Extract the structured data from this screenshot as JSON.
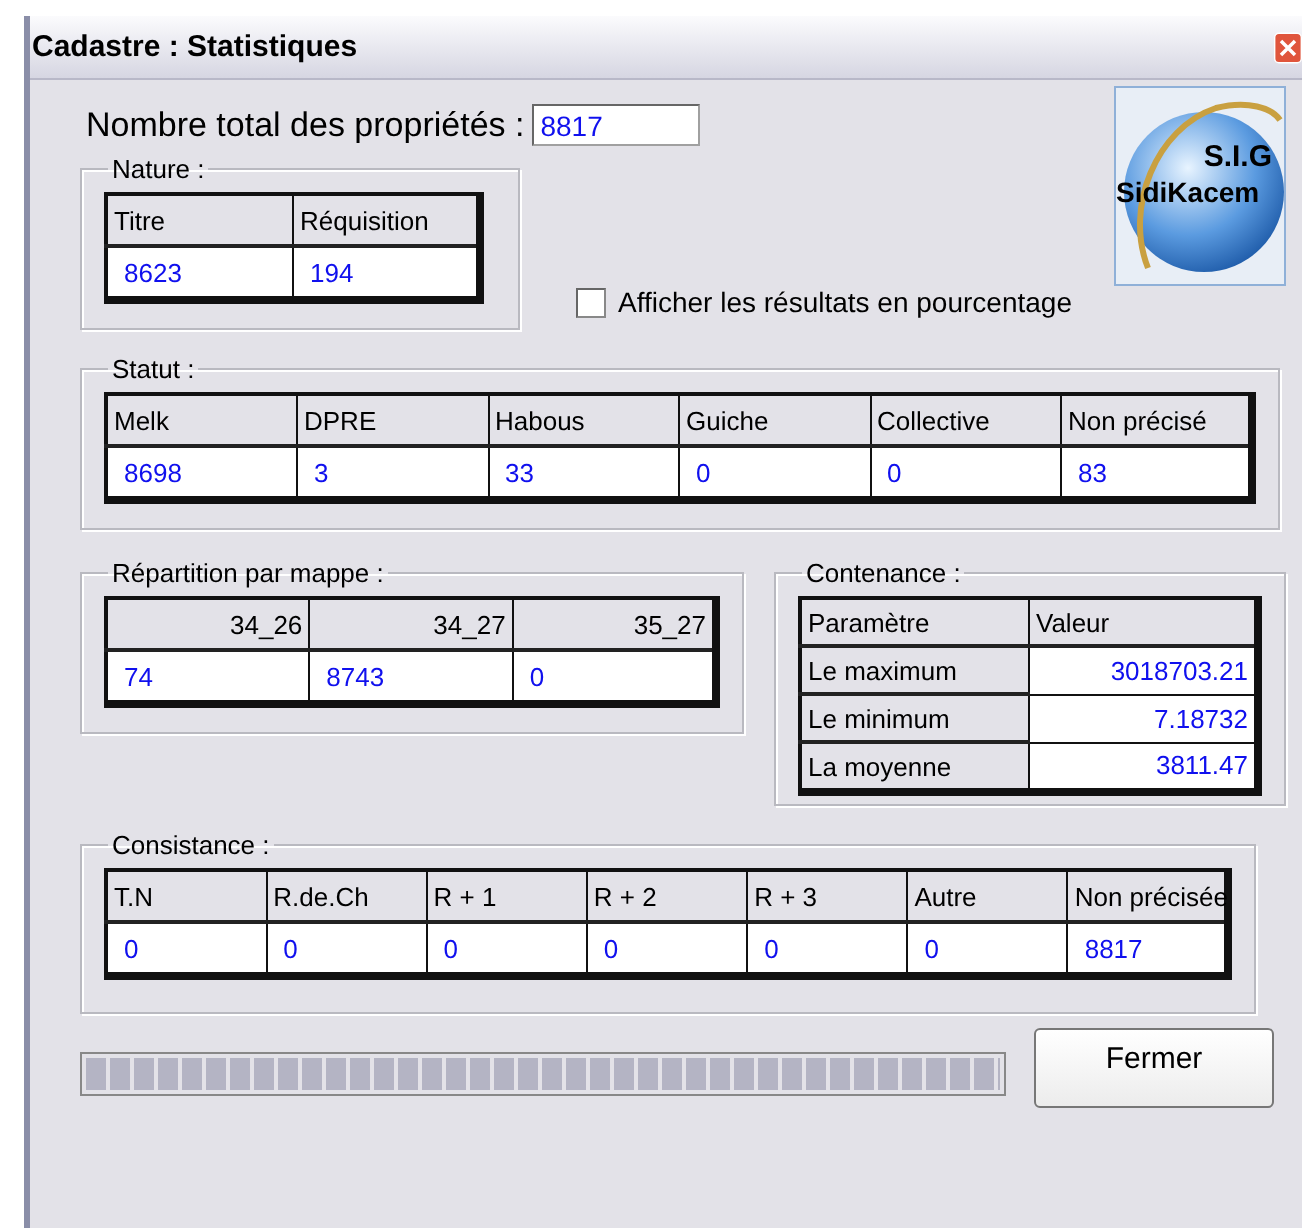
{
  "window": {
    "title": "Cadastre : Statistiques"
  },
  "total": {
    "label": "Nombre total des propriétés :",
    "value": "8817"
  },
  "logo": {
    "line1": "S.I.G",
    "line2": "SidiKacem"
  },
  "nature": {
    "title": "Nature :",
    "columns": [
      "Titre",
      "Réquisition"
    ],
    "values": [
      "8623",
      "194"
    ]
  },
  "percentage_checkbox": {
    "label": "Afficher les résultats en pourcentage",
    "checked": false
  },
  "statut": {
    "title": "Statut :",
    "columns": [
      "Melk",
      "DPRE",
      "Habous",
      "Guiche",
      "Collective",
      "Non précisé"
    ],
    "values": [
      "8698",
      "3",
      "33",
      "0",
      "0",
      "83"
    ]
  },
  "repartition": {
    "title": "Répartition par mappe :",
    "columns": [
      "34_26",
      "34_27",
      "35_27"
    ],
    "values": [
      "74",
      "8743",
      "0"
    ]
  },
  "contenance": {
    "title": "Contenance :",
    "columns": [
      "Paramètre",
      "Valeur"
    ],
    "rows": [
      {
        "parameter": "Le maximum",
        "value": "3018703.21"
      },
      {
        "parameter": "Le minimum",
        "value": "7.18732"
      },
      {
        "parameter": "La moyenne",
        "value": "3811.47"
      }
    ]
  },
  "consistance": {
    "title": "Consistance :",
    "columns": [
      "T.N",
      "R.de.Ch",
      "R + 1",
      "R + 2",
      "R + 3",
      "Autre",
      "Non précisée"
    ],
    "values": [
      "0",
      "0",
      "0",
      "0",
      "0",
      "0",
      "8817"
    ]
  },
  "progress": {
    "level": 1
  },
  "buttons": [
    {
      "label": "Fermer"
    }
  ]
}
